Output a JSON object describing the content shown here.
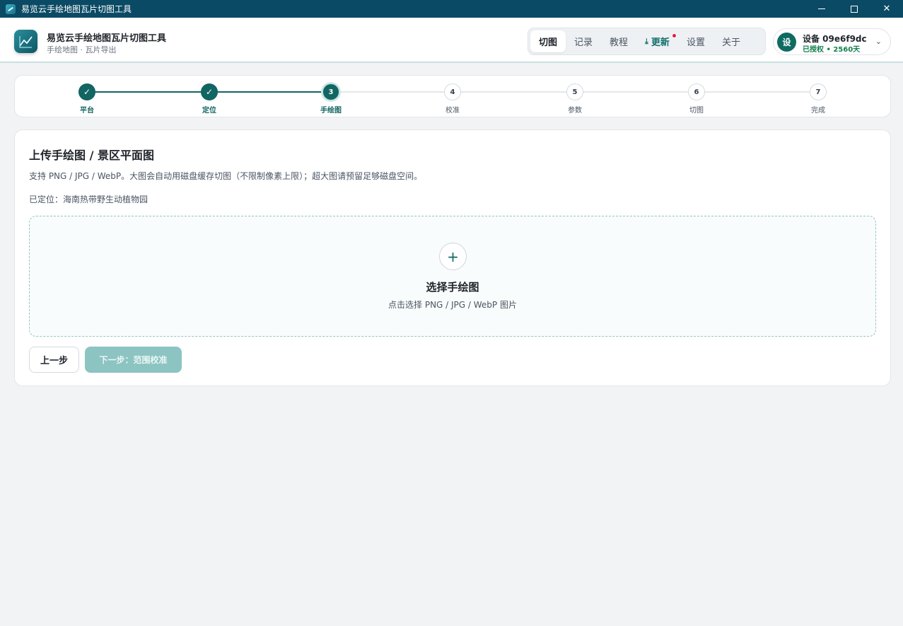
{
  "window": {
    "title": "易览云手绘地图瓦片切图工具"
  },
  "header": {
    "app_name": "易览云手绘地图瓦片切图工具",
    "app_subtitle": "手绘地图 · 瓦片导出",
    "nav": [
      {
        "label": "切图",
        "active": true
      },
      {
        "label": "记录",
        "active": false
      },
      {
        "label": "教程",
        "active": false
      },
      {
        "label": "更新",
        "active": false,
        "has_badge": true,
        "icon": "download-icon"
      },
      {
        "label": "设置",
        "active": false
      },
      {
        "label": "关于",
        "active": false
      }
    ],
    "device": {
      "avatar_text": "设",
      "name": "设备 09e6f9dc",
      "status": "已授权 • 2560天"
    }
  },
  "stepper": {
    "steps": [
      {
        "marker": "✓",
        "label": "平台",
        "state": "done"
      },
      {
        "marker": "✓",
        "label": "定位",
        "state": "done"
      },
      {
        "marker": "3",
        "label": "手绘图",
        "state": "current"
      },
      {
        "marker": "4",
        "label": "校准",
        "state": "pending"
      },
      {
        "marker": "5",
        "label": "参数",
        "state": "pending"
      },
      {
        "marker": "6",
        "label": "切图",
        "state": "pending"
      },
      {
        "marker": "7",
        "label": "完成",
        "state": "pending"
      }
    ]
  },
  "main": {
    "title": "上传手绘图 / 景区平面图",
    "description": "支持 PNG / JPG / WebP。大图会自动用磁盘缓存切图（不限制像素上限）；超大图请预留足够磁盘空间。",
    "located": "已定位：海南热带野生动植物园",
    "dropzone": {
      "plus": "+",
      "title": "选择手绘图",
      "hint": "点击选择 PNG / JPG / WebP 图片"
    },
    "prev_button": "上一步",
    "next_button": "下一步：范围校准"
  },
  "colors": {
    "titlebar": "#0b4a64",
    "accent": "#116562",
    "badge": "#e11d48",
    "status_green": "#13804d"
  }
}
